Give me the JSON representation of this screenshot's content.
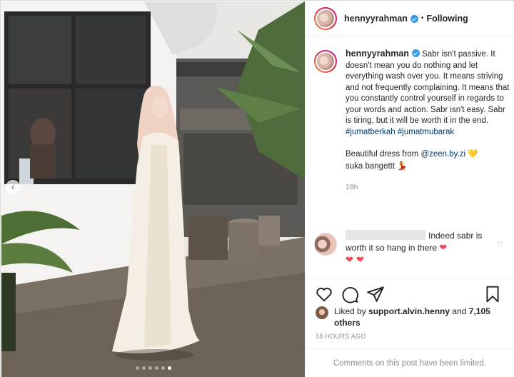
{
  "post": {
    "username": "hennyyrahman",
    "separator": "•",
    "follow_status": "Following",
    "caption": {
      "text1": "Sabr isn't passive. It doesn't mean you do nothing and let everything wash over you. It means striving and not frequently complaining. It means that you constantly control yourself in regards to your words and action. Sabr isn't easy. Sabr is tiring, but it will be worth it in the end.",
      "hashtag1": "#jumatberkah",
      "hashtag2": "#jumatmubarak",
      "text2": "Beautiful dress from",
      "mention": "@zeen.by.zi",
      "heart": "💛",
      "text3": "suka bangettt",
      "dance": "💃"
    },
    "relative_time": "18h"
  },
  "comment": {
    "text": "Indeed sabr is worth it so hang in there",
    "hearts": "❤ ❤ ❤",
    "like_icon": "heart-outline-icon"
  },
  "likes": {
    "prefix": "Liked by",
    "user": "support.alvin.henny",
    "and": "and",
    "others": "7,105 others"
  },
  "timestamp": "18 HOURS AGO",
  "comments_limited": "Comments on this post have been limited.",
  "carousel": {
    "prev_icon": "chevron-left-icon",
    "slides": 6,
    "active_index": 5
  },
  "colors": {
    "verified": "#3897f0",
    "link": "#00376b",
    "muted": "#8e8e8e",
    "heart": "#ed4956"
  }
}
